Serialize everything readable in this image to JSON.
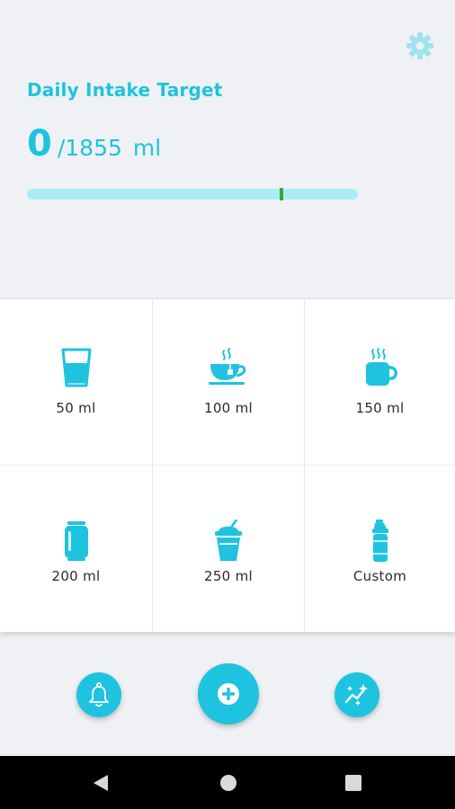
{
  "colors": {
    "accent": "#1ec3df",
    "accent_light": "#a9ecf6",
    "marker": "#36a83e",
    "background": "#eff1f5",
    "card": "#ffffff",
    "nav_bar": "#000000"
  },
  "header": {
    "settings_icon": "gear-icon",
    "title": "Daily Intake Target",
    "intake_current": "0",
    "intake_goal": "/1855",
    "intake_unit": "ml"
  },
  "progress": {
    "current_ml": 0,
    "goal_ml": 1855,
    "fill_fraction": 0,
    "marker_fraction": 0.77
  },
  "drink_options": [
    {
      "label": "50 ml",
      "icon": "glass-of-water-icon"
    },
    {
      "label": "100 ml",
      "icon": "teacup-icon"
    },
    {
      "label": "150 ml",
      "icon": "coffee-mug-icon"
    },
    {
      "label": "200 ml",
      "icon": "soda-can-icon"
    },
    {
      "label": "250 ml",
      "icon": "smoothie-cup-icon"
    },
    {
      "label": "Custom",
      "icon": "water-bottle-icon"
    }
  ],
  "actions": {
    "reminder_icon": "bell-icon",
    "add_icon": "plus-circle-icon",
    "stats_icon": "chart-sparkle-icon"
  },
  "system_nav": {
    "back_icon": "back-triangle-icon",
    "home_icon": "home-circle-icon",
    "recent_icon": "recent-square-icon"
  }
}
